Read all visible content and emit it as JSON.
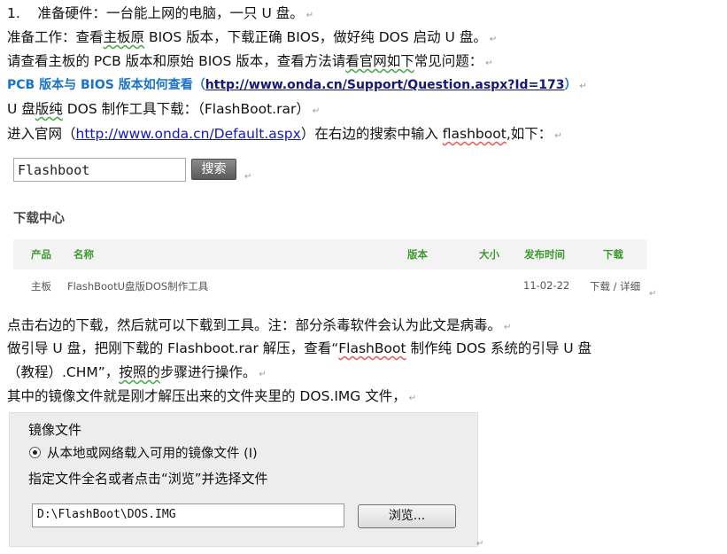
{
  "doc": {
    "line1": {
      "num": "1.",
      "text": "准备硬件：一台能上网的电脑，一只 U 盘。"
    },
    "line2": {
      "pre": "准备工作：查看",
      "wavy": "主板原",
      "post": " BIOS 版本，下载正确 BIOS，做好纯 DOS 启动 U 盘。"
    },
    "line3": {
      "pre": "请查看主板的 PCB 版本和原始 BIOS 版本，查看方法请",
      "wavy": "看官网如下",
      "post": "常见问题："
    },
    "line4": {
      "title": "PCB 版本与 BIOS 版本如何查看",
      "open": "（",
      "link": "http://www.onda.cn/Support/Question.aspx?Id=173",
      "close": "）"
    },
    "line5": {
      "pre": "U 盘",
      "wavy": "版纯",
      "post": " DOS 制作工具下载：（FlashBoot.rar）"
    },
    "line6": {
      "pre": "进入官网（",
      "link": "http://www.onda.cn/Default.aspx",
      "mid": "）在右边的搜索中输入 ",
      "wavy": "flashboot",
      "post": ",如下："
    },
    "line7": {
      "text": "点击右边的下载，然后就可以下载到工具。注：部分杀毒软件会认为此文是病毒。"
    },
    "line8": {
      "pre": "做引导 U 盘，把刚下载的 Flashboot.rar 解压，查看“",
      "wavy": "FlashBoot",
      "post": "  制作纯 DOS 系统的引导 U 盘"
    },
    "line9": {
      "pre": "（教程）.CHM”，",
      "wavy": "按照的",
      "post": "步骤进行操作。"
    },
    "line10": {
      "text": "其中的镜像文件就是刚才解压出来的文件夹里的 DOS.IMG 文件，"
    },
    "para_mark": "↵"
  },
  "search": {
    "value": "Flashboot",
    "button": "搜索"
  },
  "download_center": {
    "title": "下载中心",
    "headers": {
      "product": "产品",
      "name": "名称",
      "version": "版本",
      "size": "大小",
      "date": "发布时间",
      "download": "下载"
    },
    "row": {
      "product": "主板",
      "name": "FlashBootU盘版DOS制作工具",
      "date": "11-02-22",
      "download": "下载 / 详细"
    }
  },
  "image_panel": {
    "title": "镜像文件",
    "radio_label": "从本地或网络载入可用的镜像文件 (I)",
    "hint": "指定文件全名或者点击“浏览”并选择文件",
    "path": "D:\\FlashBoot\\DOS.IMG",
    "browse": "浏览..."
  }
}
